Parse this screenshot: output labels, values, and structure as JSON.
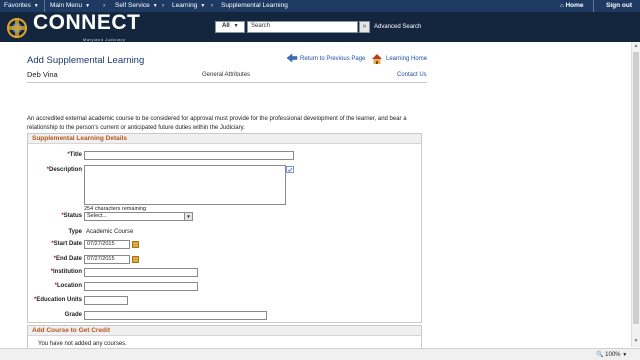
{
  "nav": {
    "favorites": "Favorites",
    "main_menu": "Main Menu",
    "self_service": "Self Service",
    "learning": "Learning",
    "supplemental": "Supplemental Learning",
    "home": "Home",
    "sign_out": "Sign out"
  },
  "header": {
    "logo_text": "CONNECT",
    "logo_sub": "Maryland Judiciary",
    "search_scope": "All",
    "search_placeholder": "Search",
    "advanced_search": "Advanced Search"
  },
  "page": {
    "title": "Add Supplemental Learning",
    "user_name": "Deb Vina",
    "general_attributes": "General Attributes",
    "contact_us": "Contact Us",
    "return_prev": "Return to Previous Page",
    "learning_home": "Learning Home",
    "intro": "An accredited external academic course to be considered for approval must provide for the professional development of the learner, and bear a relationship to the person's current or anticipated future duties within the Judiciary."
  },
  "details": {
    "heading": "Supplemental Learning Details",
    "title_label": "Title",
    "description_label": "Description",
    "chars_remaining": "254 characters remaining",
    "status_label": "Status",
    "status_value": "Select...",
    "type_label": "Type",
    "type_value": "Academic Course",
    "start_label": "Start Date",
    "start_value": "07/27/2015",
    "end_label": "End Date",
    "end_value": "07/27/2015",
    "institution_label": "Institution",
    "location_label": "Location",
    "units_label": "Education Units",
    "grade_label": "Grade"
  },
  "credit": {
    "heading": "Add Course to Get Credit",
    "empty_text": "You have not added any courses."
  },
  "status_bar": {
    "zoom": "100%"
  }
}
